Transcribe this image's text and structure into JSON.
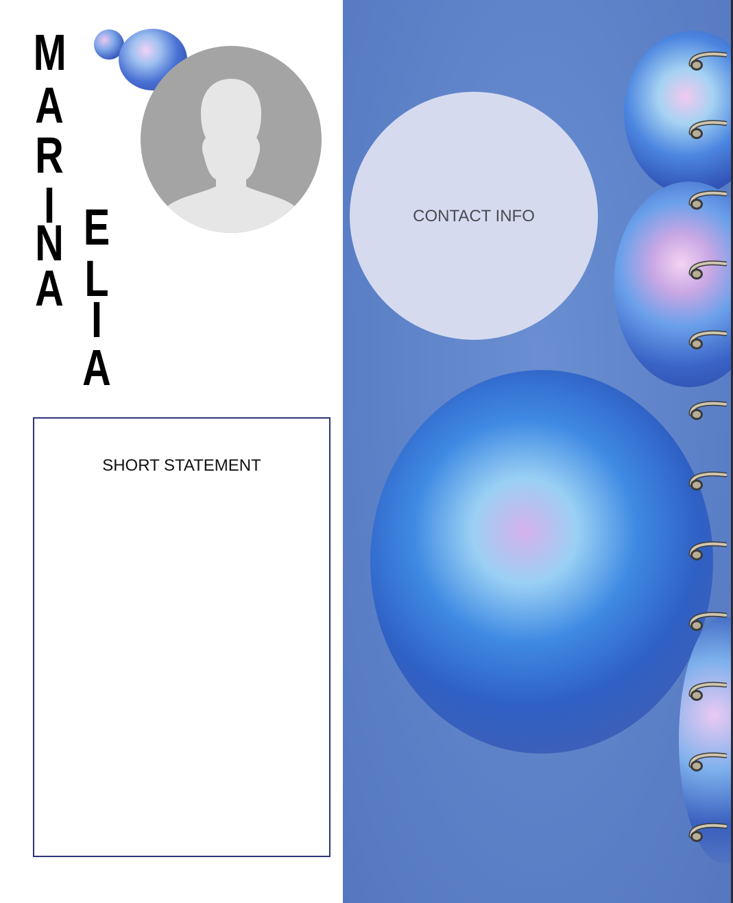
{
  "name": {
    "first": [
      "M",
      "A",
      "R",
      "I",
      "N",
      "A"
    ],
    "last": [
      "E",
      "L",
      "I",
      "A"
    ]
  },
  "photo": {
    "icon": "person-silhouette-icon"
  },
  "statement": {
    "title": "SHORT STATEMENT"
  },
  "contact": {
    "title": "CONTACT INFO"
  },
  "colors": {
    "panel_blue": "#5d82c8",
    "contact_circle": "#d5daef",
    "statement_border": "#2d3478",
    "photo_bg": "#a4a4a4"
  }
}
